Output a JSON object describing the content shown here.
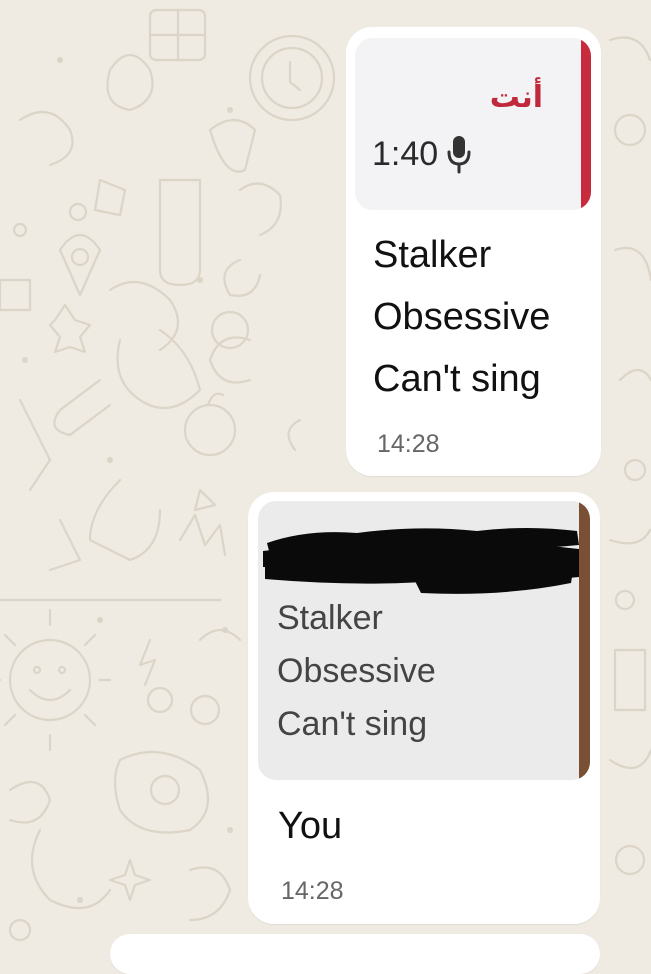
{
  "chat": {
    "messages": [
      {
        "reply_to": {
          "sender": "أنت",
          "voice_duration": "1:40",
          "icon": "microphone-icon",
          "accent_color": "#c92b3e"
        },
        "lines": [
          "Stalker",
          "Obsessive",
          "Can't sing"
        ],
        "time": "14:28"
      },
      {
        "reply_to": {
          "sender_redacted": true,
          "lines": [
            "Stalker",
            "Obsessive",
            "Can't sing"
          ],
          "accent_color": "#7a5035"
        },
        "text": "You",
        "time": "14:28"
      }
    ]
  },
  "colors": {
    "wallpaper": "#efeae2",
    "bubble": "#ffffff"
  }
}
